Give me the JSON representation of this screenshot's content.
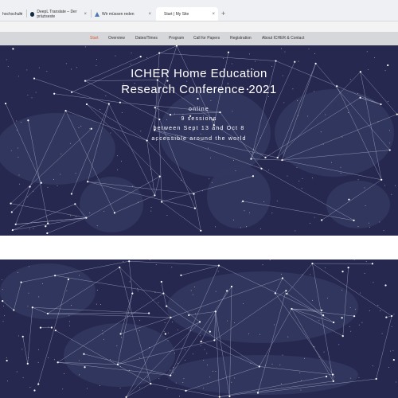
{
  "browser": {
    "tabs": [
      {
        "label": "hochschule",
        "close": "×"
      },
      {
        "label": "DeepL Translate – Der präziseste",
        "close": "×"
      },
      {
        "label": "Wir müssen reden",
        "close": "×"
      },
      {
        "label": "Start | My Site",
        "close": "×"
      }
    ],
    "new_tab": "+"
  },
  "nav": {
    "items": [
      "Start",
      "Overview",
      "Dates/Times",
      "Program",
      "Call for Papers",
      "Registration",
      "About ICHER & Contact"
    ],
    "active": "Start"
  },
  "hero": {
    "title_line1": "ICHER Home Education",
    "title_line2": "Research Conference 2021",
    "sub1": "online",
    "sub2": "9 sessions",
    "sub3": "between Sept 13 and Oct 8",
    "sub4": "accessible around the world"
  },
  "colors": {
    "active_nav": "#e05a3a",
    "hero_bg": "#26284f",
    "network": "#c9cfe6"
  }
}
